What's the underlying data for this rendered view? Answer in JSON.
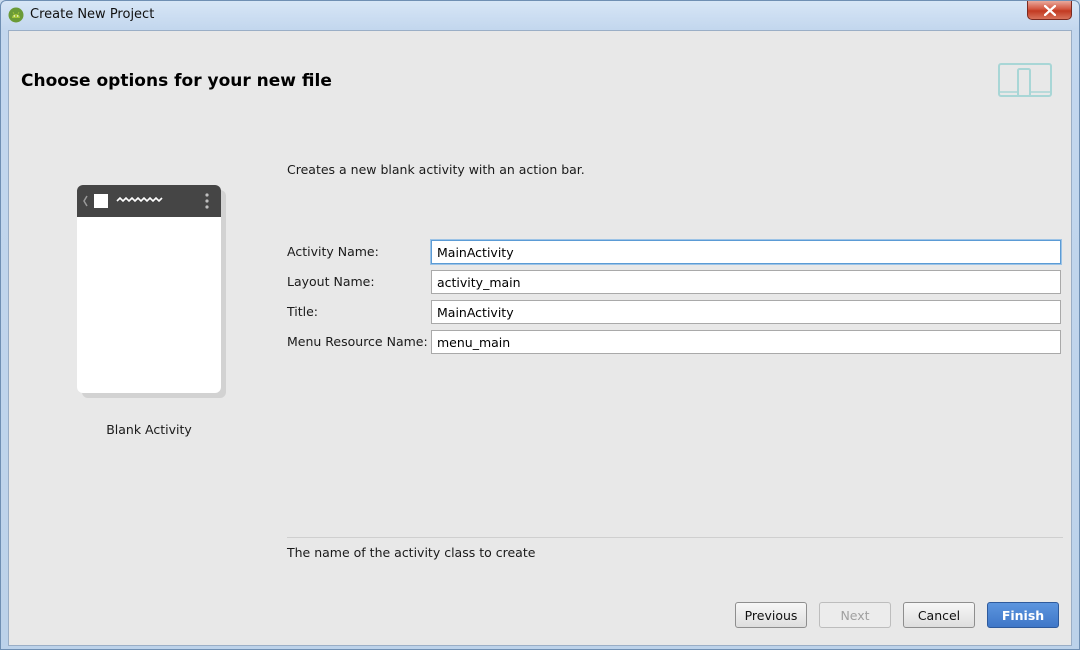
{
  "window": {
    "title": "Create New Project",
    "app_icon": "android-studio-icon",
    "close_icon": "close-icon"
  },
  "header": {
    "title": "Choose options for your new file",
    "device_icon": "phone-tablet-icon"
  },
  "preview": {
    "caption": "Blank Activity"
  },
  "form": {
    "description": "Creates a new blank activity with an action bar.",
    "fields": [
      {
        "label": "Activity Name:",
        "value": "MainActivity"
      },
      {
        "label": "Layout Name:",
        "value": "activity_main"
      },
      {
        "label": "Title:",
        "value": "MainActivity"
      },
      {
        "label": "Menu Resource Name:",
        "value": "menu_main"
      }
    ],
    "help_text": "The name of the activity class to create"
  },
  "buttons": {
    "previous": "Previous",
    "next": "Next",
    "cancel": "Cancel",
    "finish": "Finish"
  }
}
